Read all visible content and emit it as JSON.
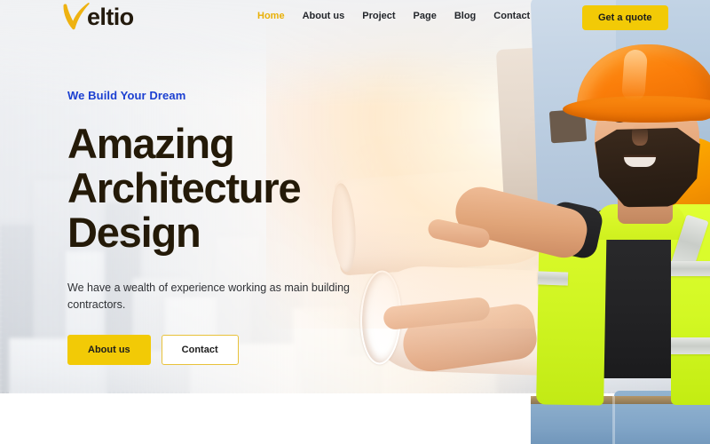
{
  "brand": {
    "logo_mark": "check-swoosh-icon",
    "logo_text": "eltio",
    "logo_full": "Veltio",
    "logo_color": "#eeb211",
    "logo_text_color": "#231a0d"
  },
  "nav": {
    "items": [
      {
        "label": "Home",
        "active": true
      },
      {
        "label": "About us",
        "active": false
      },
      {
        "label": "Project",
        "active": false
      },
      {
        "label": "Page",
        "active": false
      },
      {
        "label": "Blog",
        "active": false
      },
      {
        "label": "Contact",
        "active": false
      }
    ],
    "cta": {
      "label": "Get a quote",
      "bg": "#f2ca06",
      "color": "#1c1c1c"
    },
    "active_color": "#e9b007",
    "link_color": "#23262b"
  },
  "hero": {
    "eyebrow": "We Build Your Dream",
    "eyebrow_color": "#1b3fd1",
    "title_line1": "Amazing",
    "title_line2": "Architecture",
    "title_line3": "Design",
    "title_color": "#241a08",
    "subtitle": "We have a wealth of experience working as main building contractors.",
    "buttons": [
      {
        "label": "About us",
        "style": "primary"
      },
      {
        "label": "Contact",
        "style": "ghost"
      }
    ],
    "background": {
      "scene": "aerial-cityscape-photo",
      "overlay": "warm-sunlight-flare",
      "base_color": "#eef0f3",
      "accent_warm": "#fff3dc"
    },
    "foreground": {
      "subject": "construction-worker-pointing",
      "props": [
        "rolled-blueprints",
        "hands-holding-plans"
      ],
      "helmet_color": "#fb7e0a",
      "vest_color": "#d3f824"
    }
  },
  "theme": {
    "accent_yellow": "#f2ca06",
    "accent_blue": "#1b3fd1",
    "page_bg": "#ffffff"
  }
}
